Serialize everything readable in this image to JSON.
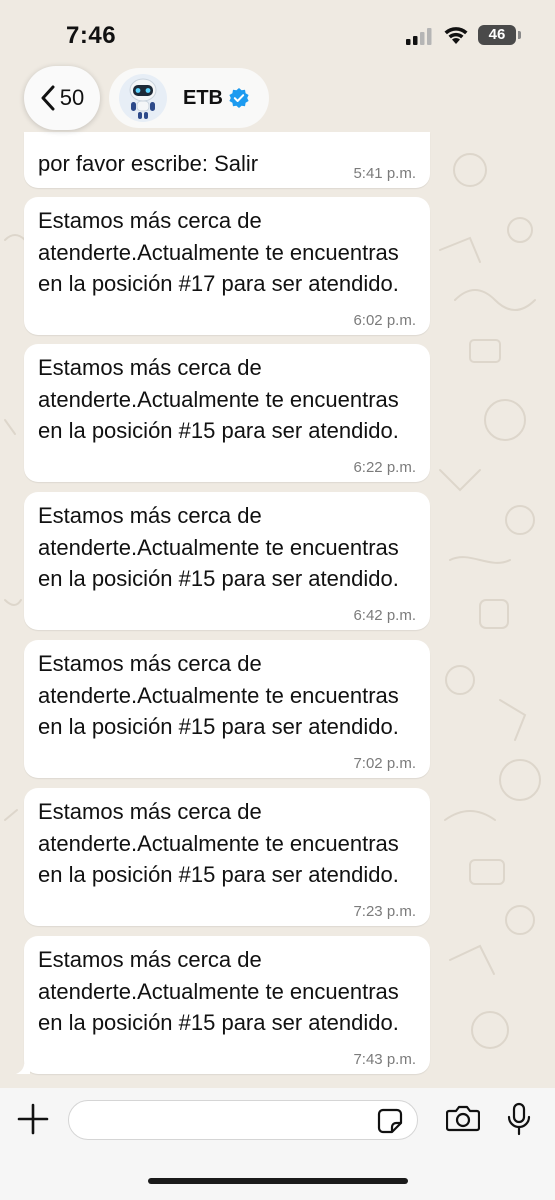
{
  "status_bar": {
    "time": "7:46",
    "battery": "46",
    "battery_level": 0.46,
    "icons": [
      "signal-icon",
      "wifi-icon",
      "battery-icon"
    ]
  },
  "header": {
    "back_count": "50",
    "contact_name": "ETB",
    "icons": [
      "chevron-left-icon",
      "robot-avatar-icon",
      "verified-badge-icon"
    ],
    "colors": {
      "verified": "#1d9bf0"
    }
  },
  "messages": [
    {
      "text": "por favor escribe: Salir",
      "time": "5:41 p.m."
    },
    {
      "text": "Estamos más cerca de atenderte.Actualmente te encuentras en la posición #17 para ser atendido.",
      "time": "6:02 p.m."
    },
    {
      "text": "Estamos más cerca de atenderte.Actualmente te encuentras en la posición #15 para ser atendido.",
      "time": "6:22 p.m."
    },
    {
      "text": "Estamos más cerca de atenderte.Actualmente te encuentras en la posición #15 para ser atendido.",
      "time": "6:42 p.m."
    },
    {
      "text": "Estamos más cerca de atenderte.Actualmente te encuentras en la posición #15 para ser atendido.",
      "time": "7:02 p.m."
    },
    {
      "text": "Estamos más cerca de atenderte.Actualmente te encuentras en la posición #15 para ser atendido.",
      "time": "7:23 p.m."
    },
    {
      "text": "Estamos más cerca de atenderte.Actualmente te encuentras en la posición #15 para ser atendido.",
      "time": "7:43 p.m."
    }
  ],
  "composer": {
    "input_value": "",
    "icons": [
      "plus-icon",
      "sticker-icon",
      "camera-icon",
      "microphone-icon"
    ]
  },
  "colors": {
    "background": "#efeae2",
    "bubble": "#ffffff",
    "timestamp": "#7b7b7b"
  }
}
